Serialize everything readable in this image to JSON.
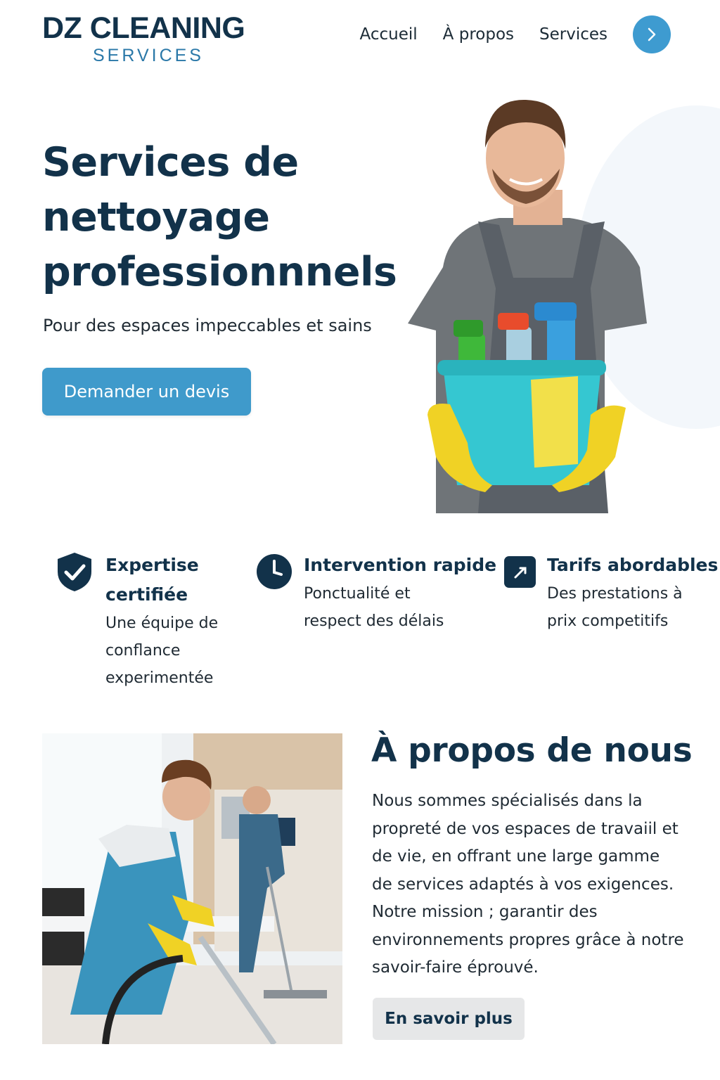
{
  "brand": {
    "name_line1": "DZ CLEANING",
    "name_line2": "SERVICES"
  },
  "nav": {
    "items": [
      {
        "label": "Accueil"
      },
      {
        "label": "À propos"
      },
      {
        "label": "Services"
      }
    ],
    "next_icon": "chevron-right-icon"
  },
  "hero": {
    "title_lines": [
      "Services de",
      "nettoyage",
      "professionnnels"
    ],
    "subtitle": "Pour des espaces impeccables et sains",
    "cta_label": "Demander un devis"
  },
  "features": [
    {
      "icon": "shield-check-icon",
      "title_lines": [
        "Expertise",
        "certifiée"
      ],
      "desc_lines": [
        "Une équipe de",
        "conflance",
        "experimentée"
      ]
    },
    {
      "icon": "clock-icon",
      "title_lines": [
        "Intervention rapide"
      ],
      "desc_lines": [
        "Ponctualité et",
        "respect des délais"
      ]
    },
    {
      "icon": "price-tag-icon",
      "title_lines": [
        "Tarifs abordables"
      ],
      "desc_lines": [
        "Des prestations à",
        "prix competitifs"
      ]
    }
  ],
  "about": {
    "title": "À propos de nous",
    "text_lines": [
      "Nous sommes spécialisés dans la",
      "propreté de vos espaces de travaiil et",
      "de vie, en offrant une large gamme",
      "de services adaptés à vos exigences.",
      "Notre mission ; garantir des",
      "environnements propres grâce à notre",
      "savoir-faire éprouvé."
    ],
    "cta_label": "En savoir plus"
  },
  "colors": {
    "primary": "#3f9acb",
    "dark": "#12324a",
    "accent": "#2a78a8",
    "button_secondary": "#e6e7e8"
  }
}
